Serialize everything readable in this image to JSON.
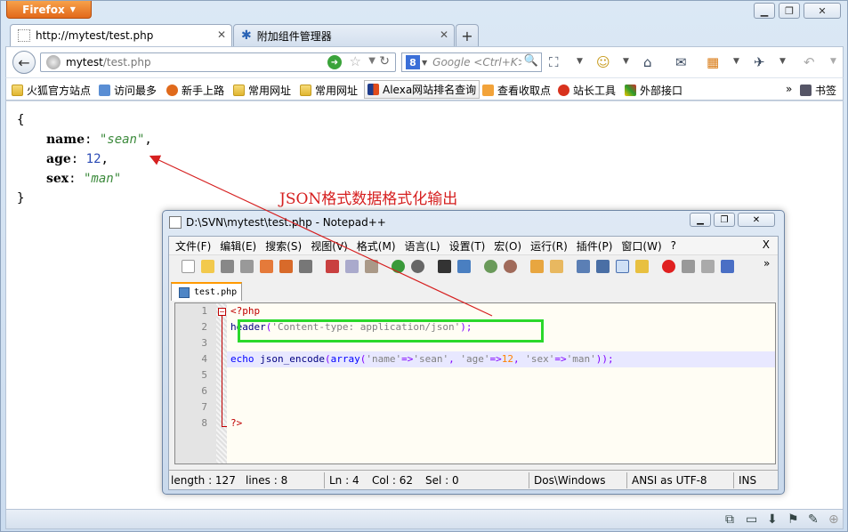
{
  "browser": {
    "menu_button": "Firefox",
    "tabs": [
      {
        "label": "http://mytest/test.php",
        "active": true
      },
      {
        "label": "附加组件管理器",
        "active": false
      }
    ],
    "url_host": "mytest",
    "url_path": "/test.php",
    "search_placeholder": "Google <Ctrl+K>",
    "bookmarks": [
      "火狐官方站点",
      "访问最多",
      "新手上路",
      "常用网址",
      "常用网址",
      "Alexa网站排名查询",
      "查看收取点",
      "站长工具",
      "外部接口"
    ],
    "bookmarks_more": "»",
    "bookmarks_label": "书签"
  },
  "json_output": {
    "open": "{",
    "close": "}",
    "name_key": "name",
    "name_value": "\"sean\"",
    "age_key": "age",
    "age_value": "12",
    "sex_key": "sex",
    "sex_value": "\"man\""
  },
  "annotation": "JSON格式数据格式化输出",
  "notepad": {
    "title": "D:\\SVN\\mytest\\test.php - Notepad++",
    "menu": [
      "文件(F)",
      "编辑(E)",
      "搜索(S)",
      "视图(V)",
      "格式(M)",
      "语言(L)",
      "设置(T)",
      "宏(O)",
      "运行(R)",
      "插件(P)",
      "窗口(W)",
      "?"
    ],
    "menu_close": "X",
    "tab": "test.php",
    "line_numbers": [
      "1",
      "2",
      "3",
      "4",
      "5",
      "6",
      "7",
      "8"
    ],
    "code": {
      "l1": "<?php",
      "l2_fn": "header",
      "l2_str": "'Content-type: application/json'",
      "l4_echo": "echo",
      "l4_fn": "json_encode",
      "l4_array": "array",
      "l4_k1": "'name'",
      "l4_v1": "'sean'",
      "l4_k2": "'age'",
      "l4_v2": "12",
      "l4_k3": "'sex'",
      "l4_v3": "'man'",
      "l8": "?>"
    },
    "status": {
      "length": "length : 127",
      "lines": "lines : 8",
      "ln": "Ln : 4",
      "col": "Col : 62",
      "sel": "Sel : 0",
      "eol": "Dos\\Windows",
      "encoding": "ANSI as UTF-8",
      "mode": "INS"
    }
  },
  "colors": {
    "annotation_red": "#d62020",
    "highlight_green": "#2bd82b",
    "firefox_orange": "#e2691b"
  }
}
